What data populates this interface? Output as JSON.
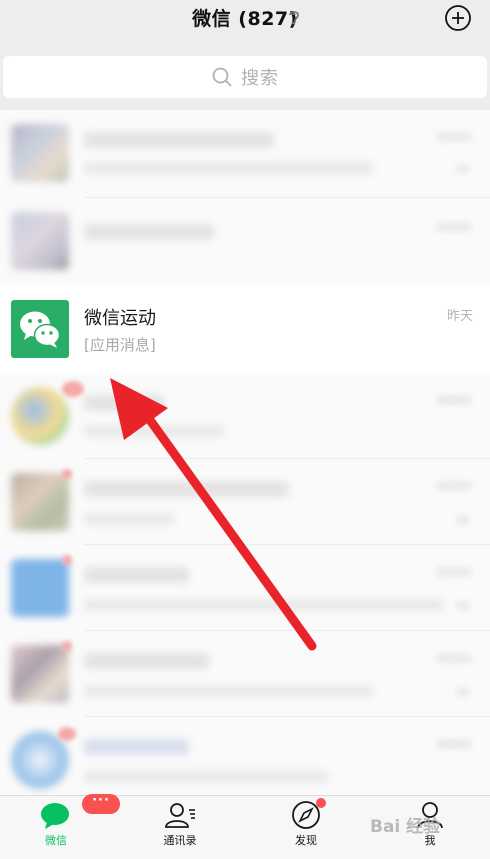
{
  "header": {
    "title": "微信 (827)",
    "icons": [
      "ear-icon",
      "plus-circle-icon"
    ]
  },
  "search": {
    "placeholder": "搜索",
    "icon": "search-icon"
  },
  "highlighted_chat": {
    "name": "微信运动",
    "message": "[应用消息]",
    "time": "昨天",
    "avatar_color": "#2aae67"
  },
  "tabs": [
    {
      "label": "微信",
      "icon": "chat-bubble-icon",
      "active": true,
      "badge": "···"
    },
    {
      "label": "通讯录",
      "icon": "contacts-icon",
      "active": false
    },
    {
      "label": "发现",
      "icon": "compass-icon",
      "active": false
    },
    {
      "label": "我",
      "icon": "person-icon",
      "active": false
    }
  ],
  "colors": {
    "accent": "#07c160",
    "badge": "#fa5151",
    "arrow": "#e8232a"
  },
  "watermark": "Bai 经验"
}
